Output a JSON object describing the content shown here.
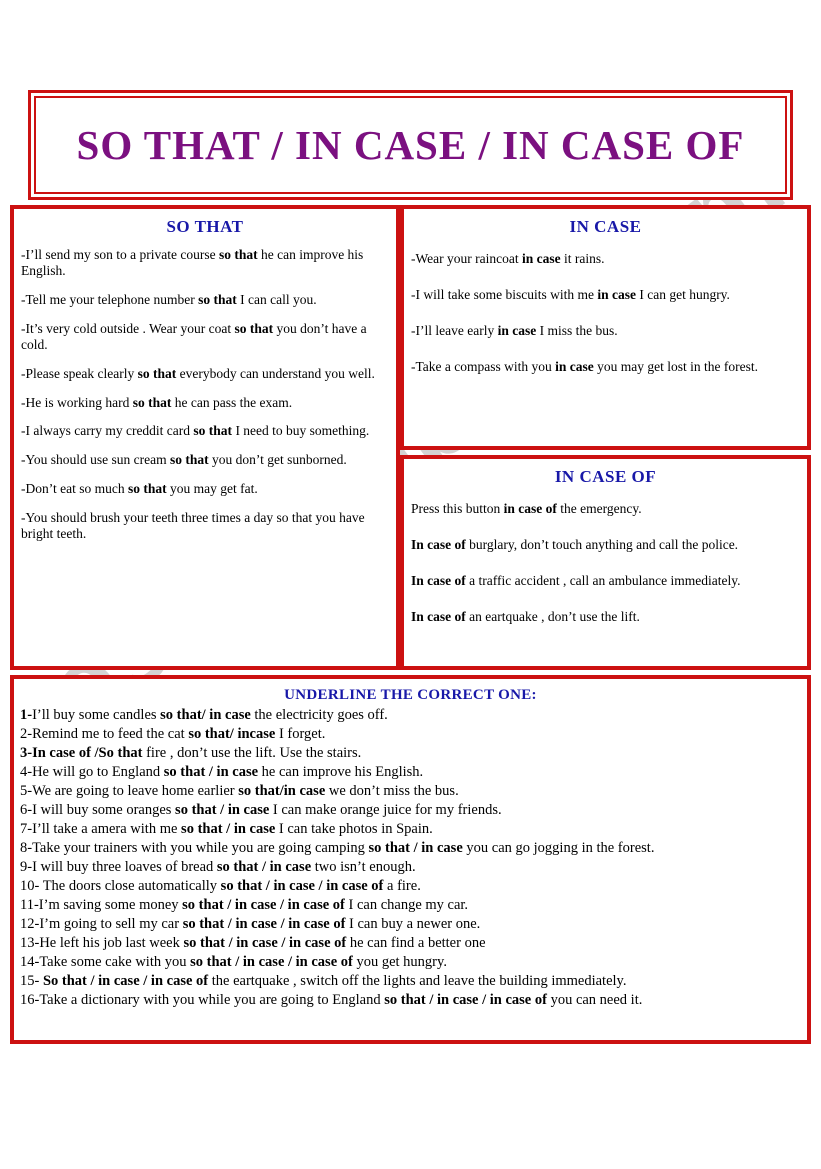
{
  "watermark": {
    "text": "eslprintables.com"
  },
  "colors": {
    "border_red": "#CC1111",
    "title_purple": "#7B1080",
    "heading_blue": "#1818A8",
    "body_black": "#000000"
  },
  "title": {
    "text": "SO THAT   /   IN CASE  /  IN CASE OF"
  },
  "panels": {
    "so_that": {
      "heading": "SO THAT",
      "sentences": [
        {
          "parts": [
            {
              "t": "-I’ll send my son  to a private course   ",
              "b": false
            },
            {
              "t": "so that",
              "b": true
            },
            {
              "t": " he can improve his English.",
              "b": false
            }
          ]
        },
        {
          "parts": [
            {
              "t": "-Tell me your telephone number ",
              "b": false
            },
            {
              "t": "so that",
              "b": true
            },
            {
              "t": " I can call you.",
              "b": false
            }
          ]
        },
        {
          "parts": [
            {
              "t": "-It’s  very cold outside . Wear your coat  ",
              "b": false
            },
            {
              "t": "so that",
              "b": true
            },
            {
              "t": " you don’t have a cold.",
              "b": false
            }
          ]
        },
        {
          "parts": [
            {
              "t": "-Please speak clearly  ",
              "b": false
            },
            {
              "t": "so that",
              "b": true
            },
            {
              "t": "  everybody can understand you well.",
              "b": false
            }
          ]
        },
        {
          "parts": [
            {
              "t": "-He is working hard ",
              "b": false
            },
            {
              "t": "so that",
              "b": true
            },
            {
              "t": " he can pass the exam.",
              "b": false
            }
          ]
        },
        {
          "parts": [
            {
              "t": "-I always carry my creddit card ",
              "b": false
            },
            {
              "t": "so that",
              "b": true
            },
            {
              "t": " I need to buy something.",
              "b": false
            }
          ]
        },
        {
          "parts": [
            {
              "t": "-You should use sun cream ",
              "b": false
            },
            {
              "t": "so that",
              "b": true
            },
            {
              "t": " you don’t get sunborned.",
              "b": false
            }
          ]
        },
        {
          "parts": [
            {
              "t": "-Don’t eat so much ",
              "b": false
            },
            {
              "t": "so that",
              "b": true
            },
            {
              "t": " you may get fat.",
              "b": false
            }
          ]
        },
        {
          "parts": [
            {
              "t": "-You should brush your teeth three times a day so that you have bright teeth.",
              "b": false
            }
          ]
        }
      ]
    },
    "in_case": {
      "heading": "IN CASE",
      "sentences": [
        {
          "parts": [
            {
              "t": "-Wear your raincoat ",
              "b": false
            },
            {
              "t": "in case",
              "b": true
            },
            {
              "t": " it rains.",
              "b": false
            }
          ]
        },
        {
          "parts": [
            {
              "t": "-I will take some biscuits  with me ",
              "b": false
            },
            {
              "t": "in case",
              "b": true
            },
            {
              "t": " I can get hungry.",
              "b": false
            }
          ]
        },
        {
          "parts": [
            {
              "t": "-I’ll leave early ",
              "b": false
            },
            {
              "t": "in case",
              "b": true
            },
            {
              "t": " I miss the bus.",
              "b": false
            }
          ]
        },
        {
          "parts": [
            {
              "t": "-Take a compass with you ",
              "b": false
            },
            {
              "t": "in case",
              "b": true
            },
            {
              "t": " you may get lost in the forest.",
              "b": false
            }
          ]
        }
      ]
    },
    "in_case_of": {
      "heading": "IN CASE OF",
      "sentences": [
        {
          "parts": [
            {
              "t": "Press this  button ",
              "b": false
            },
            {
              "t": "in case of",
              "b": true
            },
            {
              "t": " the emergency.",
              "b": false
            }
          ]
        },
        {
          "parts": [
            {
              "t": "In case of",
              "b": true
            },
            {
              "t": " burglary, don’t touch anything and call the police.",
              "b": false
            }
          ]
        },
        {
          "parts": [
            {
              "t": "In case of",
              "b": true
            },
            {
              "t": " a traffic accident , call an ambulance immediately.",
              "b": false
            }
          ]
        },
        {
          "parts": [
            {
              "t": "In case of",
              "b": true
            },
            {
              "t": " an eartquake , don’t use the lift.",
              "b": false
            }
          ]
        }
      ]
    }
  },
  "exercise": {
    "heading": "UNDERLINE THE CORRECT ONE:",
    "items": [
      {
        "parts": [
          {
            "t": "1-",
            "b": true
          },
          {
            "t": "I’ll  buy some candles ",
            "b": false
          },
          {
            "t": "so that/ in case",
            "b": true
          },
          {
            "t": " the electricity goes off.",
            "b": false
          }
        ]
      },
      {
        "parts": [
          {
            "t": "2-Remind me to feed the cat  ",
            "b": false
          },
          {
            "t": "so that/ incase",
            "b": true
          },
          {
            "t": " I forget.",
            "b": false
          }
        ]
      },
      {
        "parts": [
          {
            "t": "3-",
            "b": true
          },
          {
            "t": "In case of /So that",
            "b": true
          },
          {
            "t": " fire , don’t use the lift. Use the stairs.",
            "b": false
          }
        ]
      },
      {
        "parts": [
          {
            "t": "4-He will go to England  ",
            "b": false
          },
          {
            "t": "so that / in case",
            "b": true
          },
          {
            "t": " he can improve  his English.",
            "b": false
          }
        ]
      },
      {
        "parts": [
          {
            "t": "5-We are going to leave home earlier ",
            "b": false
          },
          {
            "t": "so that/in case",
            "b": true
          },
          {
            "t": " we don’t miss the bus.",
            "b": false
          }
        ]
      },
      {
        "parts": [
          {
            "t": "6-I will buy some oranges  ",
            "b": false
          },
          {
            "t": "so that / in case",
            "b": true
          },
          {
            "t": " I can make orange juice for my friends.",
            "b": false
          }
        ]
      },
      {
        "parts": [
          {
            "t": "7-I’ll take a  amera with me ",
            "b": false
          },
          {
            "t": "so that / in case",
            "b": true
          },
          {
            "t": " I can take photos in Spain.",
            "b": false
          }
        ]
      },
      {
        "parts": [
          {
            "t": "8-Take your trainers with you  while you are going camping  ",
            "b": false
          },
          {
            "t": "so that / in case",
            "b": true
          },
          {
            "t": " you can go jogging in the forest.",
            "b": false
          }
        ]
      },
      {
        "parts": [
          {
            "t": "9-I will buy three  loaves of bread   ",
            "b": false
          },
          {
            "t": "so that / in case",
            "b": true
          },
          {
            "t": " two  isn’t enough.",
            "b": false
          }
        ]
      },
      {
        "parts": [
          {
            "t": "10- The doors  close automatically ",
            "b": false
          },
          {
            "t": "so that / in case / in case of",
            "b": true
          },
          {
            "t": " a fire.",
            "b": false
          }
        ]
      },
      {
        "parts": [
          {
            "t": "11-I’m saving some money  ",
            "b": false
          },
          {
            "t": "so that / in case / in case of",
            "b": true
          },
          {
            "t": " I can change my car.",
            "b": false
          }
        ]
      },
      {
        "parts": [
          {
            "t": "12-I’m going to sell my car ",
            "b": false
          },
          {
            "t": "so that / in case / in case of",
            "b": true
          },
          {
            "t": " I can buy a newer one.",
            "b": false
          }
        ]
      },
      {
        "parts": [
          {
            "t": "13-He left his job last week  ",
            "b": false
          },
          {
            "t": "so that / in case / in case of",
            "b": true
          },
          {
            "t": " he can find a better one",
            "b": false
          }
        ]
      },
      {
        "parts": [
          {
            "t": "14-Take some cake  with you  ",
            "b": false
          },
          {
            "t": "so that / in case / in case of",
            "b": true
          },
          {
            "t": " you get hungry.",
            "b": false
          }
        ]
      },
      {
        "parts": [
          {
            "t": "15- ",
            "b": false
          },
          {
            "t": "So that / in case / in case of",
            "b": true
          },
          {
            "t": "  the eartquake , switch off the lights  and leave the building immediately.",
            "b": false
          }
        ]
      },
      {
        "parts": [
          {
            "t": "16-Take a dictionary with you  while you are going to  England ",
            "b": false
          },
          {
            "t": "so that / in case / in case of",
            "b": true
          },
          {
            "t": " you can need it.",
            "b": false
          }
        ]
      }
    ]
  }
}
